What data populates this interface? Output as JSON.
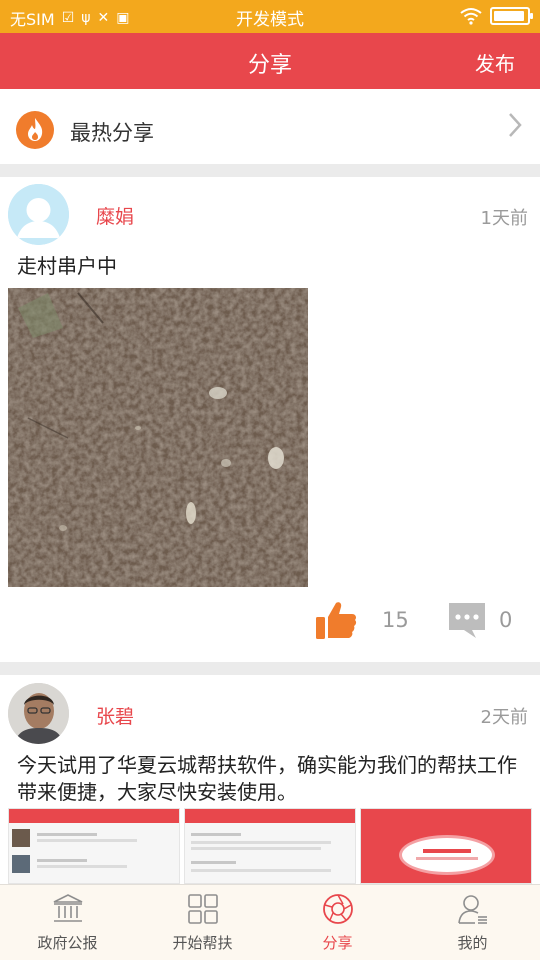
{
  "status_bar": {
    "sim": "无SIM",
    "mode": "开发模式",
    "battery_level": 0.95
  },
  "nav": {
    "title": "分享",
    "publish": "发布"
  },
  "hot_share": {
    "label": "最热分享",
    "icon": "flame-icon"
  },
  "posts": [
    {
      "username": "糜娟",
      "time": "1天前",
      "text": "走村串户中",
      "likes": "15",
      "comments": "0"
    },
    {
      "username": "张碧",
      "time": "2天前",
      "text": "今天试用了华夏云城帮扶软件，确实能为我们的帮扶工作带来便捷，大家尽快安装使用。"
    }
  ],
  "tabs": [
    {
      "label": "政府公报",
      "icon": "government-icon",
      "active": false
    },
    {
      "label": "开始帮扶",
      "icon": "grid-icon",
      "active": false
    },
    {
      "label": "分享",
      "icon": "shutter-icon",
      "active": true
    },
    {
      "label": "我的",
      "icon": "user-icon",
      "active": false
    }
  ],
  "colors": {
    "status_bar": "#f3a81d",
    "brand_red": "#e8474c",
    "like_orange": "#f07c2c",
    "muted_gray": "#9a9a9a"
  }
}
